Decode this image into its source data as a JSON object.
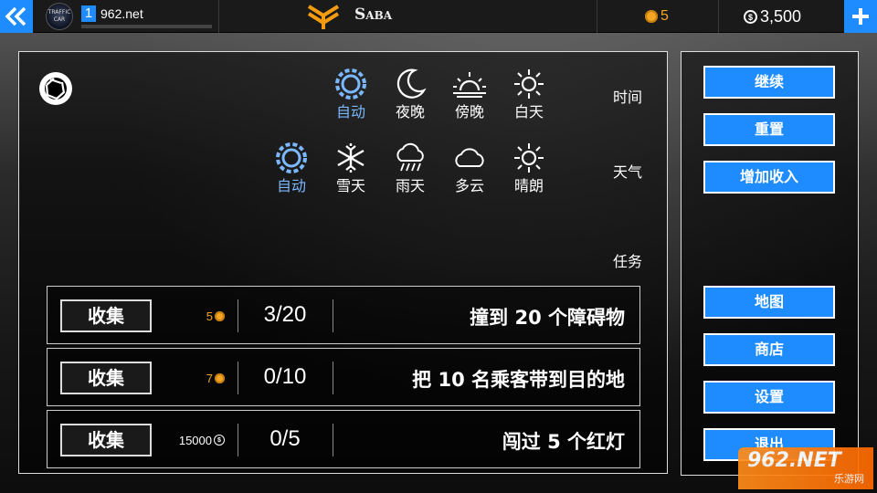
{
  "topbar": {
    "avatar_text": "TRAFFIC CAR",
    "level": "1",
    "username": "962.net",
    "xp_fraction": 0.0,
    "car_name": "Saba",
    "coins": "5",
    "cash": "3,500"
  },
  "time_row": {
    "label": "时间",
    "options": [
      {
        "label": "自动",
        "icon": "auto-gear-icon",
        "active": true
      },
      {
        "label": "夜晚",
        "icon": "moon-icon",
        "active": false
      },
      {
        "label": "傍晚",
        "icon": "sunset-icon",
        "active": false
      },
      {
        "label": "白天",
        "icon": "sun-icon",
        "active": false
      }
    ]
  },
  "weather_row": {
    "label": "天气",
    "options": [
      {
        "label": "自动",
        "icon": "auto-gear-icon",
        "active": true
      },
      {
        "label": "雪天",
        "icon": "snowflake-icon",
        "active": false
      },
      {
        "label": "雨天",
        "icon": "rain-cloud-icon",
        "active": false
      },
      {
        "label": "多云",
        "icon": "cloud-icon",
        "active": false
      },
      {
        "label": "晴朗",
        "icon": "sun-icon",
        "active": false
      }
    ]
  },
  "tasks": {
    "label": "任务",
    "items": [
      {
        "button": "收集",
        "reward": "5",
        "reward_type": "coin",
        "progress": "3/20",
        "desc": "撞到 20 个障碍物"
      },
      {
        "button": "收集",
        "reward": "7",
        "reward_type": "coin",
        "progress": "0/10",
        "desc": "把 10 名乘客带到目的地"
      },
      {
        "button": "收集",
        "reward": "15000",
        "reward_type": "cash",
        "progress": "0/5",
        "desc": "闯过 5 个红灯"
      }
    ]
  },
  "menu": {
    "continue": "继续",
    "reset": "重置",
    "add_income": "增加收入",
    "map": "地图",
    "shop": "商店",
    "settings": "设置",
    "exit": "退出"
  },
  "watermark": {
    "big": "962.NET",
    "small": "乐游网"
  },
  "colors": {
    "accent": "#1e8cff",
    "coin": "#f5a623",
    "active_option": "#7ab8ff"
  }
}
